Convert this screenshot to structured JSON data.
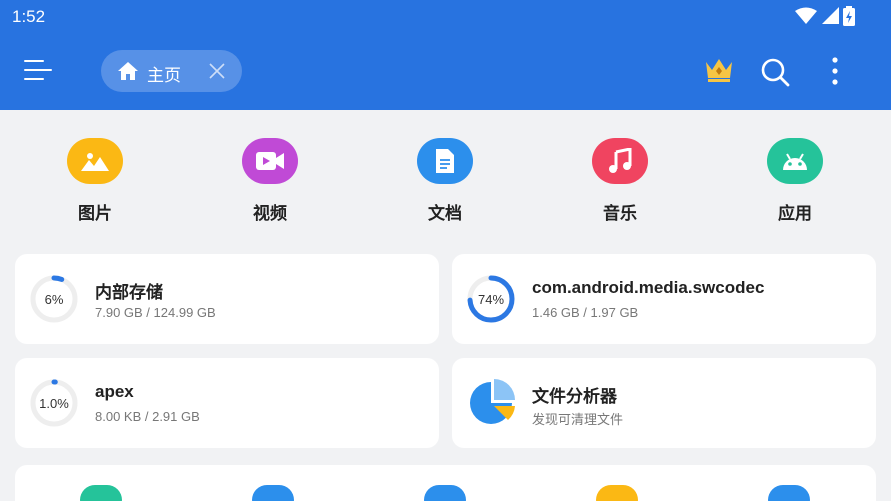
{
  "status": {
    "time": "1:52"
  },
  "header": {
    "tab_label": "主页"
  },
  "categories": [
    {
      "label": "图片",
      "icon": "image-icon",
      "color": "#fbb814"
    },
    {
      "label": "视频",
      "icon": "video-icon",
      "color": "#c04ad6"
    },
    {
      "label": "文档",
      "icon": "document-icon",
      "color": "#2c8fec"
    },
    {
      "label": "音乐",
      "icon": "music-icon",
      "color": "#f04460"
    },
    {
      "label": "应用",
      "icon": "android-icon",
      "color": "#25c39a"
    }
  ],
  "storage": [
    {
      "percent_label": "6%",
      "percent": 6,
      "title": "内部存储",
      "sub": "7.90 GB / 124.99 GB"
    },
    {
      "percent_label": "74%",
      "percent": 74,
      "title": "com.android.media.swcodec",
      "sub": "1.46 GB / 1.97 GB"
    },
    {
      "percent_label": "1.0%",
      "percent": 1,
      "title": "apex",
      "sub": "8.00 KB / 2.91 GB"
    },
    {
      "title": "文件分析器",
      "sub": "发现可清理文件"
    }
  ],
  "colors": {
    "header": "#2873e0",
    "ring_active": "#2c78e3",
    "ring_track": "#eeeeee"
  }
}
